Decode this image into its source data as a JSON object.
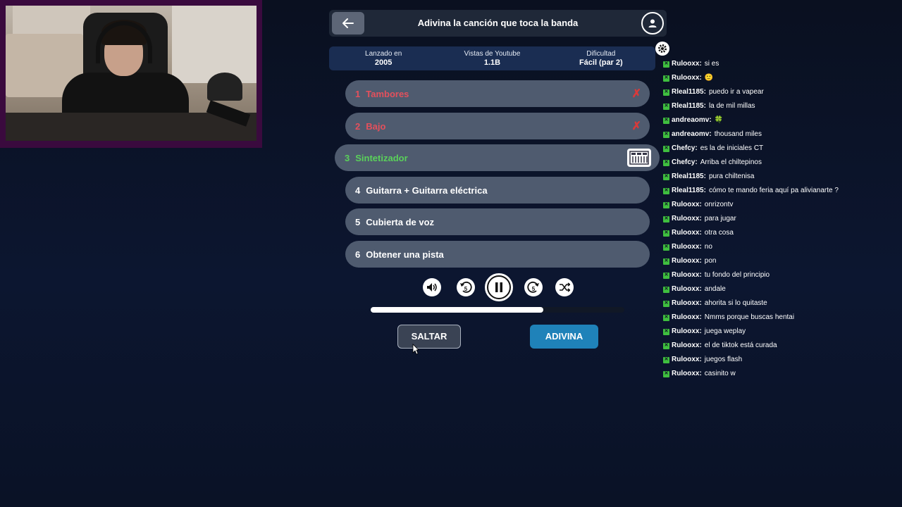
{
  "header": {
    "title": "Adivina la canción que toca la banda"
  },
  "stats": [
    {
      "label": "Lanzado en",
      "value": "2005"
    },
    {
      "label": "Vistas de Youtube",
      "value": "1.1B"
    },
    {
      "label": "Dificultad",
      "value": "Fácil (par 2)"
    }
  ],
  "tracks": [
    {
      "num": "1",
      "label": "Tambores",
      "state": "failed"
    },
    {
      "num": "2",
      "label": "Bajo",
      "state": "failed"
    },
    {
      "num": "3",
      "label": "Sintetizador",
      "state": "current"
    },
    {
      "num": "4",
      "label": "Guitarra + Guitarra eléctrica",
      "state": "normal"
    },
    {
      "num": "5",
      "label": "Cubierta de voz",
      "state": "normal"
    },
    {
      "num": "6",
      "label": "Obtener una pista",
      "state": "normal"
    }
  ],
  "player": {
    "progress": 0.68,
    "skip_seconds": "5"
  },
  "buttons": {
    "skip": "SALTAR",
    "guess": "ADIVINA"
  },
  "chat": [
    {
      "user": "Rulooxx:",
      "msg": "si es"
    },
    {
      "user": "Rulooxx:",
      "msg": "🙂"
    },
    {
      "user": "Rleal1185:",
      "msg": "puedo ir a vapear"
    },
    {
      "user": "Rleal1185:",
      "msg": "la de mil millas"
    },
    {
      "user": "andreaomv:",
      "msg": "🍀"
    },
    {
      "user": "andreaomv:",
      "msg": "thousand miles"
    },
    {
      "user": "Chefcy:",
      "msg": "es la de iniciales CT"
    },
    {
      "user": "Chefcy:",
      "msg": "Arriba el chiltepinos"
    },
    {
      "user": "Rleal1185:",
      "msg": "pura chiltenisa"
    },
    {
      "user": "Rleal1185:",
      "msg": "cómo te mando feria aquí pa alivianarte ?"
    },
    {
      "user": "Rulooxx:",
      "msg": "onrizontv"
    },
    {
      "user": "Rulooxx:",
      "msg": "para jugar"
    },
    {
      "user": "Rulooxx:",
      "msg": "otra cosa"
    },
    {
      "user": "Rulooxx:",
      "msg": "no"
    },
    {
      "user": "Rulooxx:",
      "msg": "pon"
    },
    {
      "user": "Rulooxx:",
      "msg": "tu fondo del principio"
    },
    {
      "user": "Rulooxx:",
      "msg": "andale"
    },
    {
      "user": "Rulooxx:",
      "msg": "ahorita si lo quitaste"
    },
    {
      "user": "Rulooxx:",
      "msg": "Nmms porque buscas hentai"
    },
    {
      "user": "Rulooxx:",
      "msg": "juega weplay"
    },
    {
      "user": "Rulooxx:",
      "msg": "el de tiktok está curada"
    },
    {
      "user": "Rulooxx:",
      "msg": "juegos flash"
    },
    {
      "user": "Rulooxx:",
      "msg": "casinito w"
    }
  ],
  "colors": {
    "failed": "#e4505c",
    "current": "#5ad15a",
    "accent": "#1f82b9",
    "chat_badge": "#3fbf3f"
  },
  "icons": [
    "back-arrow-icon",
    "user-icon",
    "gear-icon",
    "close-x-icon",
    "synthesizer-icon",
    "volume-icon",
    "rewind-5-icon",
    "pause-icon",
    "forward-5-icon",
    "shuffle-icon"
  ]
}
